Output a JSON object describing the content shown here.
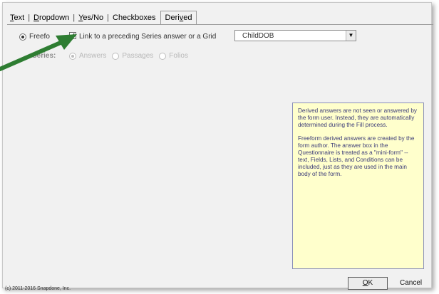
{
  "tabs": [
    {
      "pre": "",
      "underlined": "T",
      "post": "ext"
    },
    {
      "pre": "",
      "underlined": "D",
      "post": "ropdown"
    },
    {
      "pre": "",
      "underlined": "Y",
      "post": "es/No"
    },
    {
      "pre": "",
      "underlined": "",
      "post": "Checkboxes"
    },
    {
      "pre": "Deri",
      "underlined": "v",
      "post": "ed"
    }
  ],
  "active_tab_index": 4,
  "freeform": {
    "label": "Freefo",
    "selected": true
  },
  "link_checkbox": {
    "label": "Link to a preceding Series answer or a Grid",
    "checked": true,
    "mark": "✓"
  },
  "combo": {
    "value": "ChildDOB",
    "arrow": "▼"
  },
  "series": {
    "label": "Series:",
    "options": [
      {
        "label": "Answers",
        "selected": true
      },
      {
        "label": "Passages",
        "selected": false
      },
      {
        "label": "Folios",
        "selected": false
      }
    ]
  },
  "info_paragraphs": [
    "Derived answers are not seen or answered by the form user.  Instead, they are automatically determined during the Fill process.",
    "Freeform derived answers are created by the form author.  The answer box in the Questionnaire is treated as a \"mini-form\" -- text, Fields, Lists, and Conditions can be included, just as they are used in the main body of the form."
  ],
  "copyright": "(c) 2011-2016 Snapdone, Inc.",
  "ok_button": {
    "underlined": "O",
    "rest": "K"
  },
  "cancel_button": {
    "label": "Cancel"
  },
  "accent_color": "#2e7d32"
}
